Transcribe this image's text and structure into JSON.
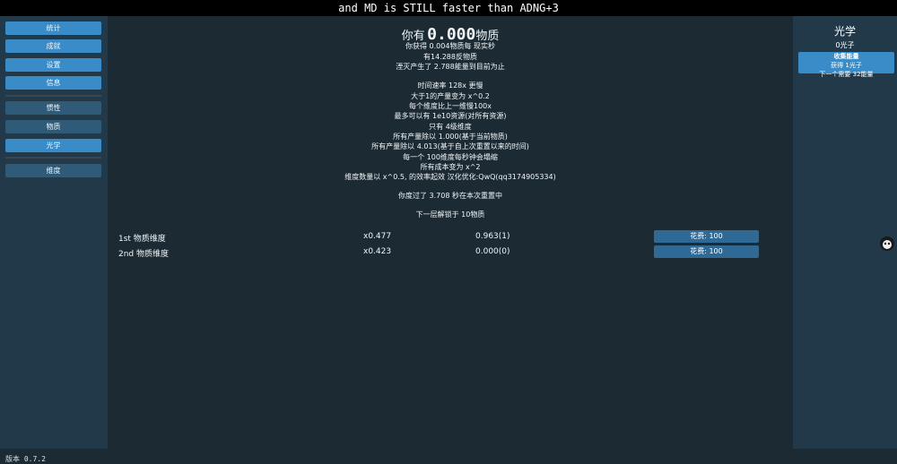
{
  "ticker": "and MD is STILL faster than ADNG+3",
  "sidebar": {
    "items": [
      {
        "label": "统计",
        "active": true
      },
      {
        "label": "成就",
        "active": true
      },
      {
        "label": "设置",
        "active": true
      },
      {
        "label": "信息",
        "active": true
      },
      {
        "label": "惯性",
        "active": false
      },
      {
        "label": "物质",
        "active": false
      },
      {
        "label": "光学",
        "active": true
      },
      {
        "label": "维度",
        "active": false
      }
    ],
    "version": "版本 0.7.2"
  },
  "main": {
    "have_prefix": "你有",
    "have_amount": "0.000",
    "have_suffix": "物质",
    "per_sec": "你获得 0.004物质每 现实秒",
    "antimatter": "有14.288反物质",
    "annihilated": "湮灭产生了 2.788能量到目前为止",
    "lines": [
      "时间速率 128x 更慢",
      "大于1的产量变为 x^0.2",
      "每个维度比上一维慢100x",
      "最多可以有 1e10资源(对所有资源)",
      "只有 4级维度",
      "所有产量除以 1.000(基于当前物质)",
      "所有产量除以 4.013(基于自上次重置以来的时间)",
      "每一个 100维度每秒钟会塌缩",
      "所有成本变为 x^2",
      "维度数量以 x^0.5, 的效率起效 汉化优化:QwQ(qq3174905334)"
    ],
    "time_spent": "你度过了 3.708 秒在本次重置中",
    "next_unlock": "下一层解锁于 10物质",
    "dimensions": [
      {
        "name": "1st 物质维度",
        "mult": "x0.477",
        "amount": "0.963(1)",
        "cost": "花费: 100"
      },
      {
        "name": "2nd 物质维度",
        "mult": "x0.423",
        "amount": "0.000(0)",
        "cost": "花费: 100"
      }
    ]
  },
  "right": {
    "title": "光学",
    "photons": "0光子",
    "gain_label": "收集能量",
    "gain": "获得 1光子",
    "next": "下一个需要 32能量"
  },
  "colors": {
    "accent": "#3a8cc8",
    "panel": "#22394a",
    "background": "#1b2a33"
  }
}
